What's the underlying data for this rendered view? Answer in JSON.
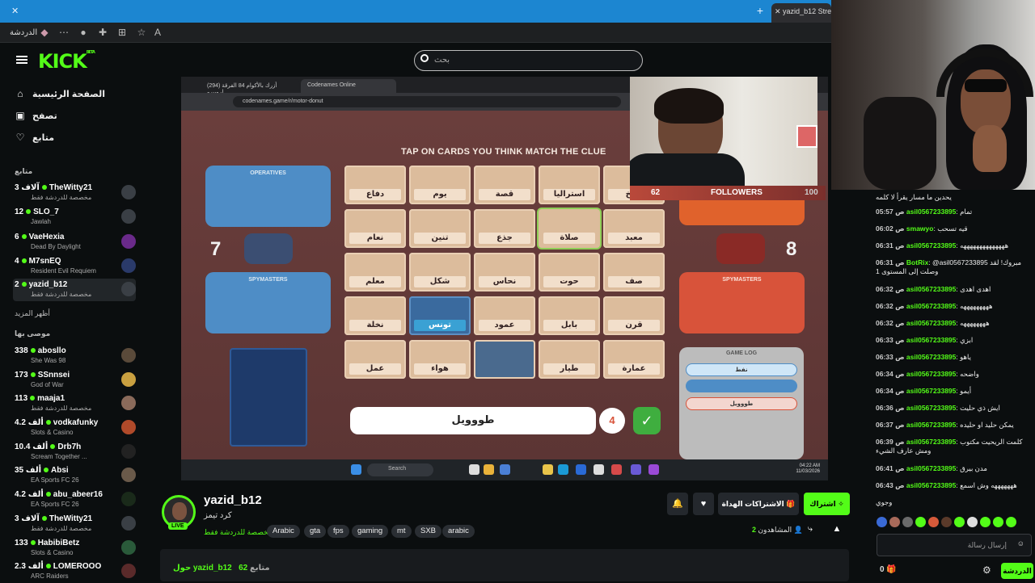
{
  "browser": {
    "tab_title": "yazid_b12 Stream",
    "bar_label": "الدردشة"
  },
  "kick": {
    "logo": "KICK",
    "logo_sup": "BETA",
    "search_placeholder": "بحث"
  },
  "sidebar": {
    "nav": [
      {
        "label": "الصفحة الرئيسية",
        "icon": "home-icon"
      },
      {
        "label": "تصفح",
        "icon": "browse-icon"
      },
      {
        "label": "متابع",
        "icon": "heart-icon"
      }
    ],
    "following_header": "متابع",
    "following": [
      {
        "count": "3 آلاف",
        "name": "TheWitty21",
        "game": "مخصصة للدردشة فقط"
      },
      {
        "count": "12",
        "name": "SLO_7",
        "game": "Jawlah"
      },
      {
        "count": "6",
        "name": "VaeHexia",
        "game": "Dead By Daylight"
      },
      {
        "count": "4",
        "name": "M7snEQ",
        "game": "Resident Evil Requiem"
      },
      {
        "count": "2",
        "name": "yazid_b12",
        "game": "مخصصة للدردشة فقط"
      }
    ],
    "show_more": "أظهر المزيد",
    "recommended_header": "موصى بها",
    "recommended": [
      {
        "count": "338",
        "name": "abosllo",
        "game": "She Was 98"
      },
      {
        "count": "173",
        "name": "SSnnsei",
        "game": "God of War"
      },
      {
        "count": "113",
        "name": "maaja1",
        "game": "مخصصة للدردشة فقط"
      },
      {
        "count": "4.2 ألف",
        "name": "vodkafunky",
        "game": "Slots & Casino"
      },
      {
        "count": "10.4 ألف",
        "name": "Drb7h",
        "game": "Scream Together ..."
      },
      {
        "count": "35 ألف",
        "name": "Absi",
        "game": "EA Sports FC 26"
      },
      {
        "count": "4.2 ألف",
        "name": "abu_abeer16",
        "game": "EA Sports FC 26"
      },
      {
        "count": "3 آلاف",
        "name": "TheWitty21",
        "game": "مخصصة للدردشة فقط"
      },
      {
        "count": "133",
        "name": "HabibiBetz",
        "game": "Slots & Casino"
      },
      {
        "count": "2.3 ألف",
        "name": "LOMEROOO",
        "game": "ARC Raiders"
      }
    ]
  },
  "stream_browser": {
    "tab1": "(294) أزرك بالأكوام 84 الفرقة لروبيرو",
    "tab2": "Codenames Online",
    "url": "codenames.game/r/motor-donut"
  },
  "game": {
    "header": "TAP ON CARDS YOU THINK MATCH THE CLUE",
    "operatives_label": "OPERATIVES",
    "spymasters_label": "SPYMASTERS",
    "blue_score": "7",
    "red_score": "8",
    "cards": [
      [
        "دفاع",
        "يوم",
        "قصة",
        "استراليا",
        "طبخ"
      ],
      [
        "نعام",
        "تنين",
        "جذع",
        "صلاة",
        "معبد"
      ],
      [
        "معلم",
        "شكل",
        "نحاس",
        "حوت",
        "صف"
      ],
      [
        "نخلة",
        "تونس",
        "عمود",
        "بابل",
        "قرن"
      ],
      [
        "عمل",
        "هواء",
        "",
        "طيار",
        "عمارة"
      ]
    ],
    "clue_word": "طووويل",
    "clue_number": "4",
    "game_log_title": "GAME LOG",
    "log_entries": [
      "نفط",
      "طووويل"
    ],
    "followers_label": "FOLLOWERS",
    "followers_count": "62",
    "followers_goal": "100",
    "taskbar_search": "Search",
    "clock_time": "04:22 AM",
    "clock_date": "11/03/2026"
  },
  "streamer": {
    "username": "yazid_b12",
    "status": "كرد تيمز",
    "category": "مخصصة للدردشة فقط",
    "live_badge": "LIVE",
    "tags": [
      "Arabic",
      "gta",
      "fps",
      "gaming",
      "mt",
      "SXB",
      "arabic"
    ],
    "subscribe_label": "اشتراك",
    "gift_label": "الاشتراكات الهداة",
    "viewers_label": "المشاهدون",
    "viewers_count": "2",
    "about_followers": "62",
    "about_followers_label": "متابع",
    "about_title": "حول yazid_b12"
  },
  "chat": {
    "messages": [
      {
        "time": "",
        "user": "",
        "text": "يحدين ما مسار يقرأ لا كلمه"
      },
      {
        "time": "05:57 ص",
        "user": "asil0567233895",
        "text": "تمام"
      },
      {
        "time": "06:02 ص",
        "user": "smawyo",
        "text": "قيه تسحب"
      },
      {
        "time": "06:31 ص",
        "user": "asil0567233895",
        "text": "ههههههههههههههه"
      },
      {
        "time": "06:31 ص",
        "user": "BotRix",
        "text": "@asil0567233895 مبروك! لقد وصلت إلى المستوى 1"
      },
      {
        "time": "06:32 ص",
        "user": "asil0567233895",
        "text": "اهدى اهدى"
      },
      {
        "time": "06:32 ص",
        "user": "asil0567233895",
        "text": "هههههههههه"
      },
      {
        "time": "06:32 ص",
        "user": "asil0567233895",
        "text": "ههههههههه"
      },
      {
        "time": "06:33 ص",
        "user": "asil0567233895",
        "text": "ابزي"
      },
      {
        "time": "06:33 ص",
        "user": "asil0567233895",
        "text": "ياهو"
      },
      {
        "time": "06:34 ص",
        "user": "asil0567233895",
        "text": "واضحه"
      },
      {
        "time": "06:34 ص",
        "user": "asil0567233895",
        "text": "أيمو"
      },
      {
        "time": "06:36 ص",
        "user": "asil0567233895",
        "text": "ايش ذي حليت"
      },
      {
        "time": "06:37 ص",
        "user": "asil0567233895",
        "text": "يمكن حليد او حليده"
      },
      {
        "time": "06:39 ص",
        "user": "asil0567233895",
        "text": "كلمت الريحيت مكتوب ومش عارف الشيء"
      },
      {
        "time": "06:41 ص",
        "user": "asil0567233895",
        "text": "مدن بيرق"
      },
      {
        "time": "06:43 ص",
        "user": "asil0567233895",
        "text": "هههههههه وش اسمع"
      },
      {
        "time": "",
        "user": "",
        "text": "وجوي"
      }
    ],
    "input_placeholder": "إرسال رسالة",
    "chat_button": "الدردشة",
    "points": "0"
  }
}
